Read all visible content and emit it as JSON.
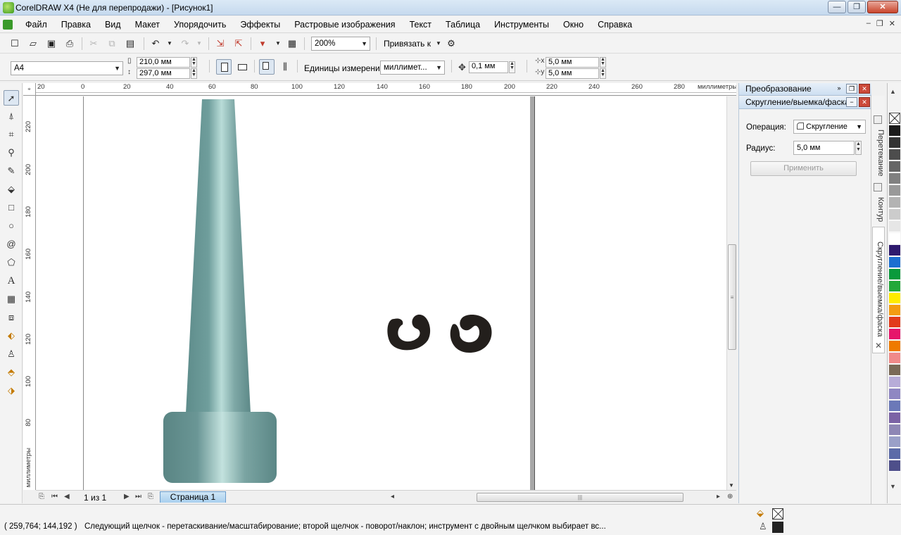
{
  "window": {
    "title": "CorelDRAW X4 (Не для перепродажи) - [Рисунок1]",
    "controls": [
      "—",
      "❐",
      "✕"
    ]
  },
  "menu": [
    "Файл",
    "Правка",
    "Вид",
    "Макет",
    "Упорядочить",
    "Эффекты",
    "Растровые изображения",
    "Текст",
    "Таблица",
    "Инструменты",
    "Окно",
    "Справка"
  ],
  "toolbar": {
    "zoom": "200%",
    "snap_to": "Привязать к"
  },
  "property_bar": {
    "page_size": "A4",
    "width": "210,0 мм",
    "height": "297,0 мм",
    "units_label": "Единицы измерения:",
    "units_value": "миллимет...",
    "nudge": "0,1 мм",
    "dup_x": "5,0 мм",
    "dup_y": "5,0 мм"
  },
  "rulers": {
    "unit": "миллиметры",
    "h_ticks": [
      "20",
      "0",
      "20",
      "40",
      "60",
      "80",
      "100",
      "120",
      "140",
      "160",
      "180",
      "200",
      "220",
      "240",
      "260",
      "280"
    ],
    "v_ticks": [
      "220",
      "200",
      "180",
      "160",
      "140",
      "120",
      "100",
      "80"
    ]
  },
  "page_nav": {
    "count": "1 из 1",
    "tab": "Страница 1"
  },
  "docker": {
    "transform_title": "Преобразование",
    "fillet_title": "Скругление/выемка/фаска",
    "operation_label": "Операция:",
    "operation_value": "Скругление",
    "radius_label": "Радиус:",
    "radius_value": "5,0 мм",
    "apply_button": "Применить",
    "side_tabs": [
      "Перетекание",
      "Контур",
      "Скругление/выемка/фаска"
    ]
  },
  "palette": [
    "#1a1a1a",
    "#333333",
    "#4d4d4d",
    "#666666",
    "#808080",
    "#999999",
    "#b3b3b3",
    "#cccccc",
    "#e6e6e6",
    "#ffffff",
    "#2e1a6e",
    "#1c6fd1",
    "#0a9a3c",
    "#22a83a",
    "#ffec00",
    "#f39c12",
    "#e23b1b",
    "#e6156b",
    "#ee7a00",
    "#f08a8a",
    "#7a6a58",
    "#b7acd8",
    "#8f87c2",
    "#6b79b8",
    "#7b63a5",
    "#8e87b5",
    "#9aa0c8",
    "#5c6ba8",
    "#4e4f8a"
  ],
  "status": {
    "coords": "( 259,764; 144,192 )",
    "message": "Следующий щелчок - перетаскивание/масштабирование; второй щелчок - поворот/наклон; инструмент с двойным щелчком выбирает вс..."
  }
}
